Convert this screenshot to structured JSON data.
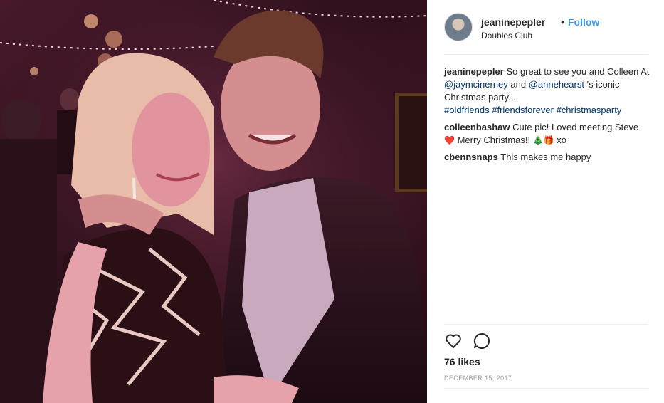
{
  "post": {
    "username": "jeaninepepler",
    "separator": "•",
    "follow_label": "Follow",
    "location": "Doubles Club"
  },
  "caption": {
    "username": "jeaninepepler",
    "text_1": "So great to see you and Colleen At",
    "mention_1": "@jaymcinerney",
    "text_2": "and",
    "mention_2": "@annehearst",
    "text_3": "'s iconic Christmas party. .",
    "hashtags": [
      "#oldfriends",
      "#friendsforever",
      "#christmasparty"
    ]
  },
  "comments": [
    {
      "username": "colleenbashaw",
      "text": "Cute pic! Loved meeting Steve",
      "text_2": "Merry Christmas!!",
      "text_3": "xo",
      "emoji_1": "❤️",
      "emoji_2": "🎄",
      "emoji_3": "🎁"
    },
    {
      "username": "cbennsnaps",
      "text": "This makes me happy"
    }
  ],
  "engagement": {
    "likes_label": "76 likes",
    "date": "DECEMBER 15, 2017"
  },
  "icons": {
    "like": "heart-outline-icon",
    "comment": "speech-bubble-icon"
  },
  "colors": {
    "follow": "#3897f0",
    "link": "#003569",
    "divider": "#efefef",
    "muted": "#999999"
  }
}
